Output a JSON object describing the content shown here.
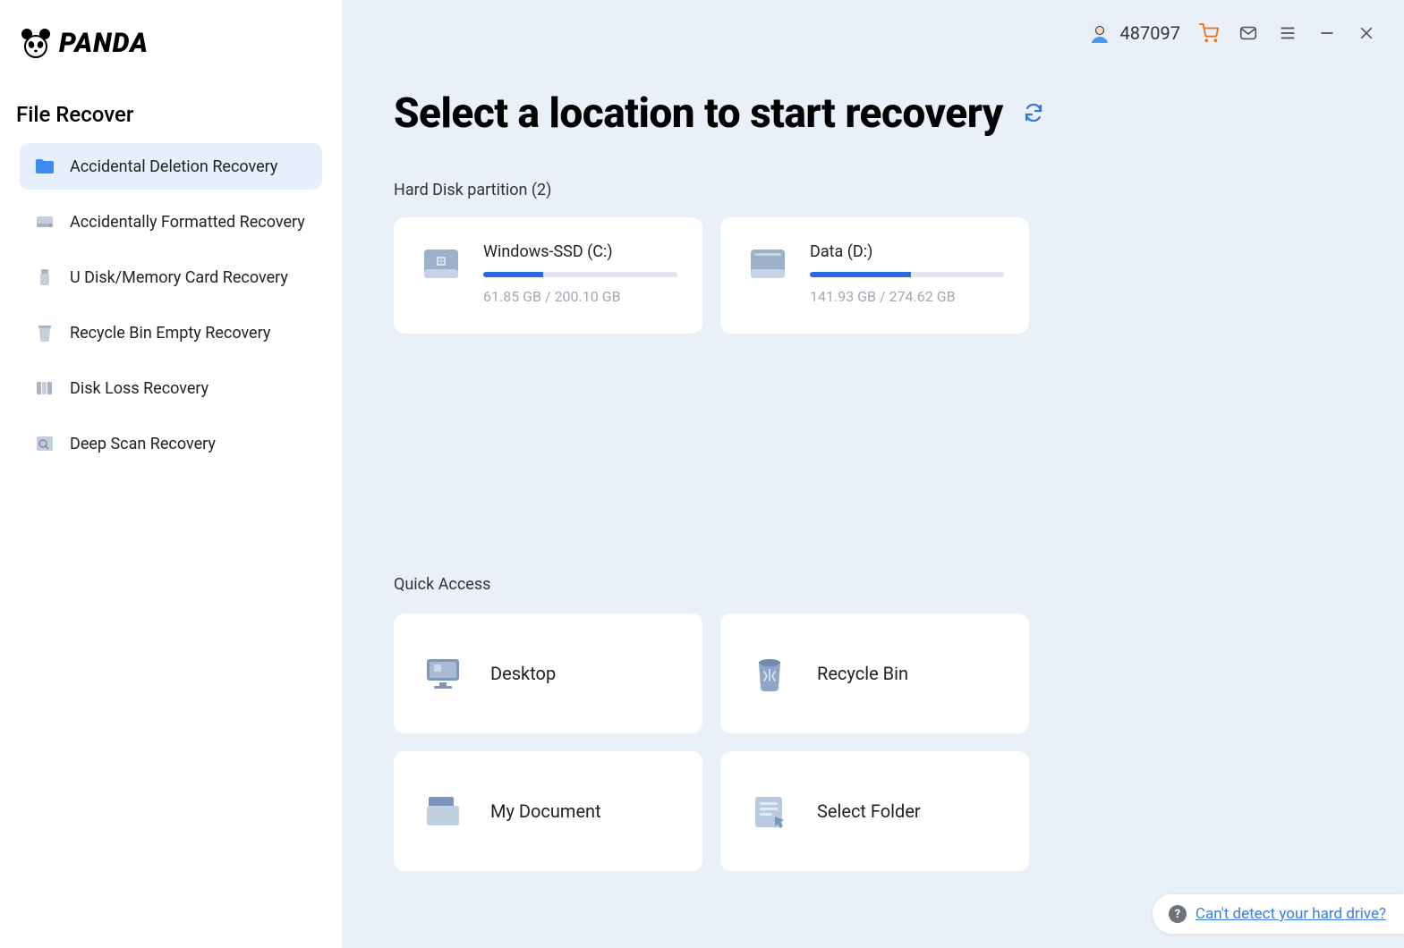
{
  "app": {
    "brand": "PANDA"
  },
  "header": {
    "user_number": "487097"
  },
  "sidebar": {
    "title": "File Recover",
    "items": [
      {
        "label": "Accidental Deletion Recovery"
      },
      {
        "label": "Accidentally Formatted Recovery"
      },
      {
        "label": "U Disk/Memory Card Recovery"
      },
      {
        "label": "Recycle Bin Empty Recovery"
      },
      {
        "label": "Disk Loss Recovery"
      },
      {
        "label": "Deep Scan Recovery"
      }
    ]
  },
  "main": {
    "title": "Select a location to start recovery",
    "partition_label": "Hard Disk partition   (2)",
    "partitions": [
      {
        "name": "Windows-SSD   (C:)",
        "used": "61.85 GB / 200.10 GB",
        "percent": 31
      },
      {
        "name": "Data   (D:)",
        "used": "141.93 GB / 274.62 GB",
        "percent": 52
      }
    ],
    "quick_label": "Quick Access",
    "quick": [
      {
        "label": "Desktop"
      },
      {
        "label": "Recycle Bin"
      },
      {
        "label": "My Document"
      },
      {
        "label": "Select Folder"
      }
    ]
  },
  "help": {
    "text": "Can't detect your hard drive?"
  }
}
